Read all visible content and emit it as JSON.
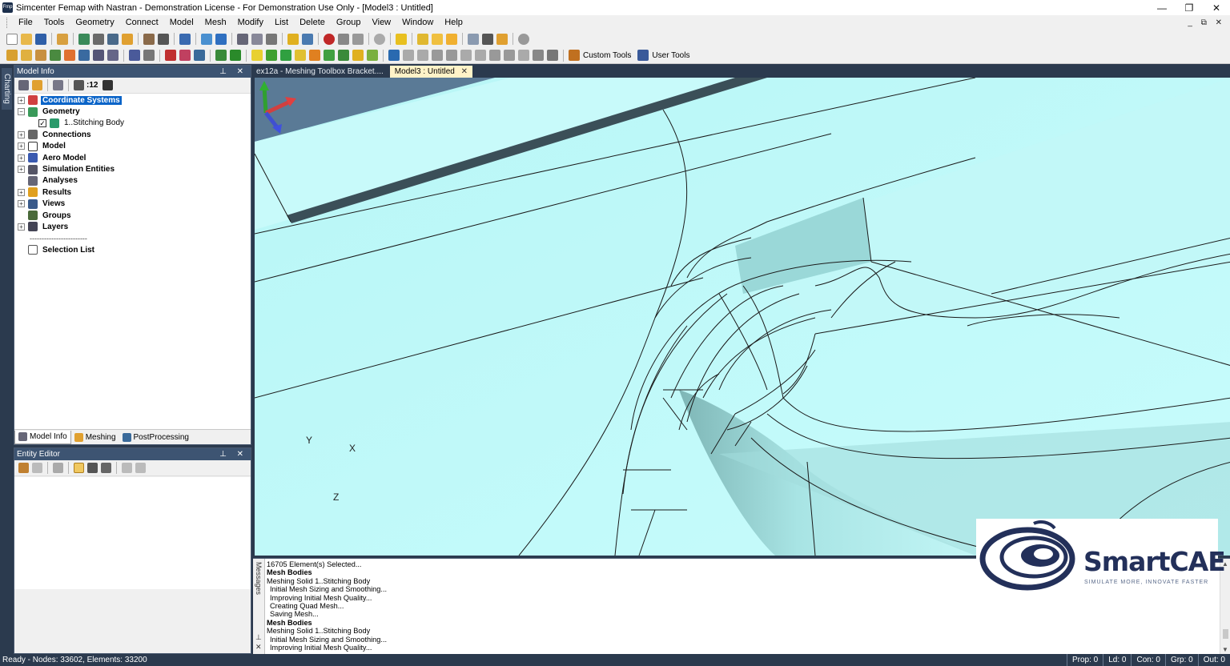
{
  "window": {
    "title": "Simcenter Femap with Nastran - Demonstration License - For Demonstration Use Only - [Model3 : Untitled]",
    "app_icon_text": "Fmp",
    "minimize": "—",
    "restore": "❐",
    "close": "✕",
    "mdi_controls": "_ ⧉ ✕"
  },
  "menu": [
    "File",
    "Tools",
    "Geometry",
    "Connect",
    "Model",
    "Mesh",
    "Modify",
    "List",
    "Delete",
    "Group",
    "View",
    "Window",
    "Help"
  ],
  "toolbar": {
    "custom_tools": "Custom Tools",
    "user_tools": "User Tools"
  },
  "left_strip": {
    "tab": "Charting"
  },
  "model_info": {
    "title": "Model Info",
    "ctrls": "⊥ ✕",
    "toolbar_text": ":12",
    "tree": [
      {
        "label": "Coordinate Systems",
        "expander": "+",
        "selected": true
      },
      {
        "label": "Geometry",
        "expander": "−"
      },
      {
        "label": "1..Stitching Body",
        "child": true
      },
      {
        "label": "Connections",
        "expander": "+"
      },
      {
        "label": "Model",
        "expander": "+"
      },
      {
        "label": "Aero Model",
        "expander": "+"
      },
      {
        "label": "Simulation Entities",
        "expander": "+"
      },
      {
        "label": "Analyses",
        "expander": ""
      },
      {
        "label": "Results",
        "expander": "+"
      },
      {
        "label": "Views",
        "expander": "+"
      },
      {
        "label": "Groups",
        "expander": ""
      },
      {
        "label": "Layers",
        "expander": "+"
      },
      {
        "label": "------------------------",
        "separator": true
      },
      {
        "label": "Selection List",
        "expander": ""
      }
    ],
    "checkbox_mark": "✓",
    "tabs": [
      "Model Info",
      "Meshing",
      "PostProcessing"
    ]
  },
  "entity_editor": {
    "title": "Entity Editor",
    "ctrls": "⊥ ✕"
  },
  "doc_tabs": [
    {
      "label": "ex12a - Meshing Toolbox Bracket....",
      "active": false
    },
    {
      "label": "Model3 : Untitled",
      "active": true,
      "close": "✕"
    }
  ],
  "triad": {
    "x": "X",
    "y": "Y",
    "z": "Z"
  },
  "logo": {
    "name": "SmartCAE",
    "tagline": "SIMULATE MORE, INNOVATE FASTER"
  },
  "messages": {
    "side_label": "Messages",
    "side_ctrls": "⊥ ✕",
    "lines": [
      {
        "text": "16705 Element(s) Selected...",
        "style": "normal"
      },
      {
        "text": "Mesh Bodies",
        "style": "bold"
      },
      {
        "text": "Meshing Solid 1..Stitching Body",
        "style": "normal"
      },
      {
        "text": "Initial Mesh Sizing and Smoothing...",
        "style": "indent"
      },
      {
        "text": "Improving Initial Mesh Quality...",
        "style": "indent"
      },
      {
        "text": "Creating Quad Mesh...",
        "style": "indent"
      },
      {
        "text": "Saving Mesh...",
        "style": "indent"
      },
      {
        "text": "Mesh Bodies",
        "style": "bold"
      },
      {
        "text": "Meshing Solid 1..Stitching Body",
        "style": "normal"
      },
      {
        "text": "Initial Mesh Sizing and Smoothing...",
        "style": "indent"
      },
      {
        "text": "Improving Initial Mesh Quality...",
        "style": "indent"
      }
    ],
    "scroll_up": "▲",
    "scroll_down": "▼"
  },
  "status": {
    "left": "Ready - Nodes: 33602,  Elements: 33200",
    "cells": [
      "Prop: 0",
      "Ld: 0",
      "Con: 0",
      "Grp: 0",
      "Out: 0"
    ]
  }
}
